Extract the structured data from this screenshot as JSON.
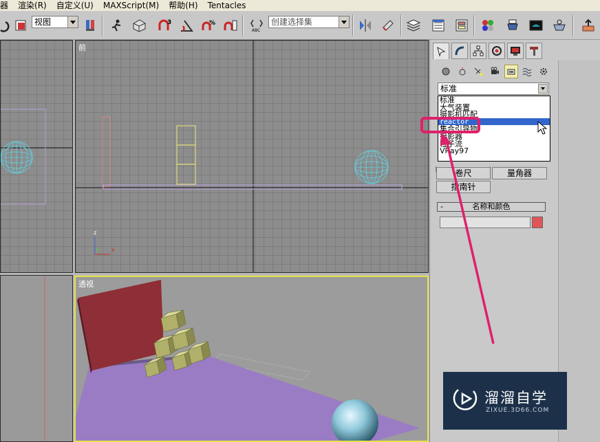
{
  "menubar": {
    "items": [
      "器",
      "渲染(R)",
      "自定义(U)",
      "MAXScript(M)",
      "帮助(H)",
      "Tentacles"
    ]
  },
  "toolbar": {
    "view_combo": "视图",
    "selection_set_combo": "创建选择集",
    "icons": [
      "redo-icon",
      "select-region-icon",
      "reference-coordinate-dropdown",
      "pivot-icon",
      "select-manipulate-icon",
      "keyboard-shortcut-icon",
      "snap-3-icon",
      "angle-snap-icon",
      "percent-snap-icon",
      "spinner-snap-icon",
      "edit-named-selection-icon",
      "mirror-icon",
      "align-icon",
      "layer-manager-icon",
      "curve-editor-icon",
      "schematic-view-icon",
      "material-editor-icon",
      "render-setup-icon",
      "rendered-frame-icon",
      "quick-render-icon",
      "reactor-icon"
    ]
  },
  "viewports": {
    "left_label": "",
    "front_label": "前",
    "perspective_label": "透视",
    "axis_z": "z",
    "axis_y": "y",
    "axis_x": "x"
  },
  "command_panel": {
    "category_selected": "标准",
    "dropdown_options": [
      "标准",
      "大气装置",
      "摄影机匹配",
      "reactor",
      "集合引导物",
      "摄影器",
      "粒子流",
      "VRay97"
    ],
    "selected_option": "reactor",
    "buttons": {
      "tape": "卷尺",
      "protractor": "量角器",
      "compass": "指南针"
    },
    "rollout": {
      "minus": "-",
      "title": "名称和颜色"
    },
    "swatch_color": "#e05555"
  },
  "watermark": {
    "brand": "溜溜自学",
    "url": "ZIXUE.3D66.COM"
  },
  "colors": {
    "highlight_box": "#e0206a",
    "viewport_active_border": "#e8e04a",
    "sphere": "#5fd4e6"
  }
}
